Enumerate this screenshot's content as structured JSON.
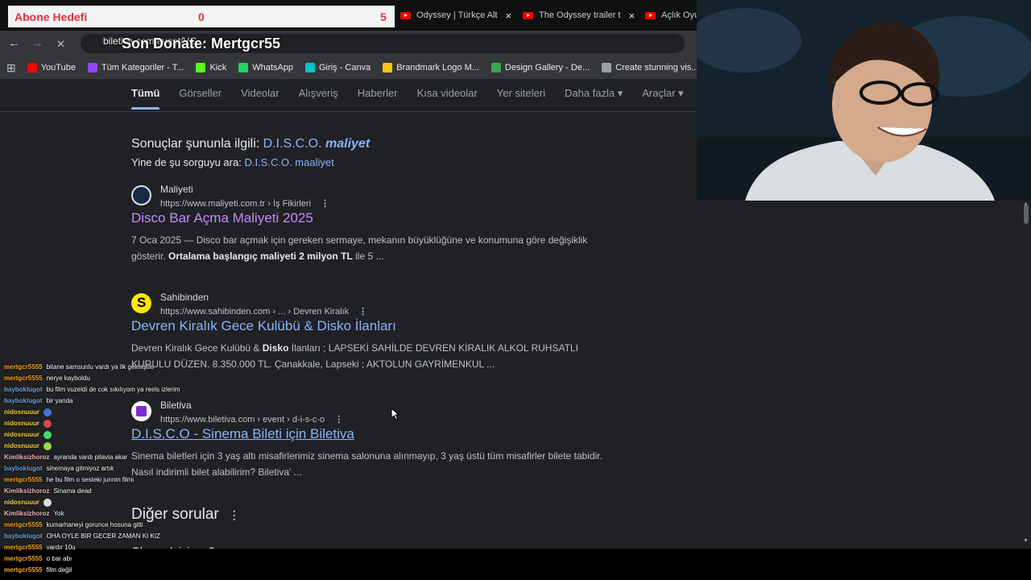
{
  "goal": {
    "label": "Abone Hedefi",
    "current": "0",
    "target": "5"
  },
  "tabs": [
    {
      "title": "Odyssey | Türkçe Alt",
      "close": "×"
    },
    {
      "title": "The Odyssey trailer t",
      "close": "×"
    },
    {
      "title": "Açlık Oyun",
      "close": ""
    }
  ],
  "address": {
    "url": "biletiva.com/event/VC...",
    "donate": "Son Donate: Mertgcr55",
    "back": "←",
    "forward": "→",
    "stop": "✕",
    "apps": "⊞"
  },
  "bookmarks": [
    {
      "label": "YouTube",
      "icon": "youtube-icon",
      "color": "#ff0000"
    },
    {
      "label": "Tüm Kategoriler - T...",
      "icon": "twitch-icon",
      "color": "#9146ff"
    },
    {
      "label": "Kick",
      "icon": "kick-icon",
      "color": "#53fc18"
    },
    {
      "label": "WhatsApp",
      "icon": "whatsapp-icon",
      "color": "#25d366"
    },
    {
      "label": "Giriş - Canva",
      "icon": "canva-icon",
      "color": "#00c4cc"
    },
    {
      "label": "Brandmark Logo M...",
      "icon": "brandmark-icon",
      "color": "#f5c518"
    },
    {
      "label": "Design Gallery - De...",
      "icon": "sparkle-icon",
      "color": "#34a853"
    },
    {
      "label": "Create stunning vis...",
      "icon": "circle-icon",
      "color": "#9aa0a6"
    }
  ],
  "search_tabs": [
    "Tümü",
    "Görseller",
    "Videolar",
    "Alışveriş",
    "Haberler",
    "Kısa videolar",
    "Yer siteleri",
    "Daha fazla ▾",
    "Araçlar ▾"
  ],
  "correction": {
    "prefix": "Sonuçlar şununla ilgili:",
    "query_plain": "D.I.S.C.O.",
    "query_bold": "maliyet",
    "retry_prefix": "Yine de şu sorguyu ara:",
    "retry_query": "D.I.S.C.O. maaliyet"
  },
  "results": [
    {
      "site": "Maliyeti",
      "url": "https://www.maliyeti.com.tr › İş Fikirleri",
      "title": "Disco Bar Açma Maliyeti 2025",
      "snippet_1": "7 Oca 2025 — Disco bar açmak için gereken sermaye, mekanın büyüklüğüne ve konumuna göre değişiklik gösterir. ",
      "snippet_bold": "Ortalama başlangıç maliyeti 2 milyon TL",
      "snippet_2": " ile 5 ..."
    },
    {
      "site": "Sahibinden",
      "url": "https://www.sahibinden.com › ... › Devren Kiralık",
      "title": "Devren Kiralık Gece Kulübü & Disko İlanları",
      "snippet_1": "Devren Kiralık Gece Kulübü & ",
      "snippet_bold": "Disko",
      "snippet_2": " İlanları ; LAPSEKİ SAHİLDE DEVREN KİRALIK ALKOL RUHSATLI KURULU DÜZEN. 8.350.000 TL. Çanakkale, Lapseki ; AKTOLUN GAYRİMENKUL ..."
    },
    {
      "site": "Biletiva",
      "url": "https://www.biletiva.com › event › d-i-s-c-o",
      "title": "D.I.S.C.O - Sinema Bileti için Biletiva",
      "snippet_1": "Sinema biletleri için 3 yaş altı misafirlerimiz sinema salonuna alınmayıp, 3 yaş üstü tüm misafirler bilete tabidir. Nasıl indirimli bilet alabilirim? Biletiva' ...",
      "snippet_bold": "",
      "snippet_2": ""
    }
  ],
  "more_questions": "Diğer sorular",
  "more_questions_next": "Oluşmak için ...?",
  "chat": [
    {
      "user": "mertgcr5555",
      "color": "#f5a623",
      "text": "bitane samsunlu vardı ya ilk gelmiştiiii"
    },
    {
      "user": "mertgcr5555",
      "color": "#f5a623",
      "text": "nerye kayboldu"
    },
    {
      "user": "bayboklugot",
      "color": "#6fa8dc",
      "text": "bu film vuzeldi de cok sıkılıyom ya reels izlerim"
    },
    {
      "user": "bayboklugot",
      "color": "#6fa8dc",
      "text": "bir yanda"
    },
    {
      "user": "nidosnuuur",
      "color": "#f7d54a",
      "text": "",
      "emote": "#4a6fd8"
    },
    {
      "user": "nidosnuuur",
      "color": "#f7d54a",
      "text": "",
      "emote": "#d84a4a"
    },
    {
      "user": "nidosnuuur",
      "color": "#f7d54a",
      "text": "",
      "emote": "#4ad86a"
    },
    {
      "user": "nidosnuuur",
      "color": "#f7d54a",
      "text": "",
      "emote": "#9ad84a"
    },
    {
      "user": "Kimliksizhoroz",
      "color": "#f4b6c2",
      "text": "ayranda vardı pilavla akar"
    },
    {
      "user": "bayboklugot",
      "color": "#6fa8dc",
      "text": "sinemaya gitmiyoz artık"
    },
    {
      "user": "mertgcr5555",
      "color": "#f5a623",
      "text": "he bu film o sesteki junnin filmi"
    },
    {
      "user": "Kimliksizhoroz",
      "color": "#f4b6c2",
      "text": "Sinama dead"
    },
    {
      "user": "nidosnuuur",
      "color": "#f7d54a",
      "text": "",
      "emote": "#dddddd"
    },
    {
      "user": "Kimliksizhoroz",
      "color": "#f4b6c2",
      "text": "Yok"
    },
    {
      "user": "mertgcr5555",
      "color": "#f5a623",
      "text": "kumarhaneyi gorunce hosuna gitti"
    },
    {
      "user": "bayboklugot",
      "color": "#6fa8dc",
      "text": "OHA OYLE BIR GECER ZAMAN KI KIZ"
    },
    {
      "user": "mertgcr5555",
      "color": "#f5a623",
      "text": "vardır 10u"
    },
    {
      "user": "mertgcr5555",
      "color": "#f5a623",
      "text": "o bar abı"
    },
    {
      "user": "mertgcr5555",
      "color": "#f5a623",
      "text": "film değil"
    }
  ]
}
